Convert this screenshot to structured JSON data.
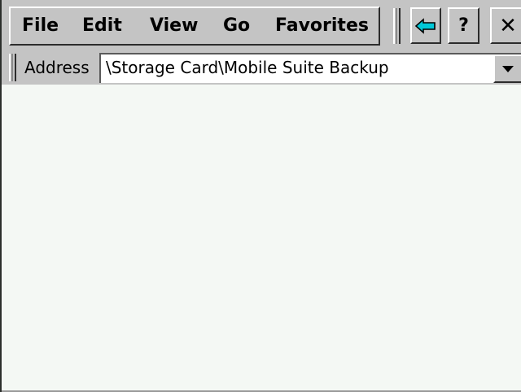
{
  "menu": {
    "items": [
      {
        "label": "File"
      },
      {
        "label": "Edit"
      },
      {
        "label": "View"
      },
      {
        "label": "Go"
      },
      {
        "label": "Favorites"
      }
    ]
  },
  "toolbar": {
    "back_icon": "back-arrow-icon",
    "help_label": "?",
    "close_label": "✕"
  },
  "address": {
    "label": "Address",
    "value": "\\Storage Card\\Mobile Suite Backup",
    "dropdown_icon": "chevron-down-icon"
  },
  "colors": {
    "chrome": "#c4c4c4",
    "content_background": "#f4f8f4",
    "back_arrow": "#00c8d8"
  }
}
